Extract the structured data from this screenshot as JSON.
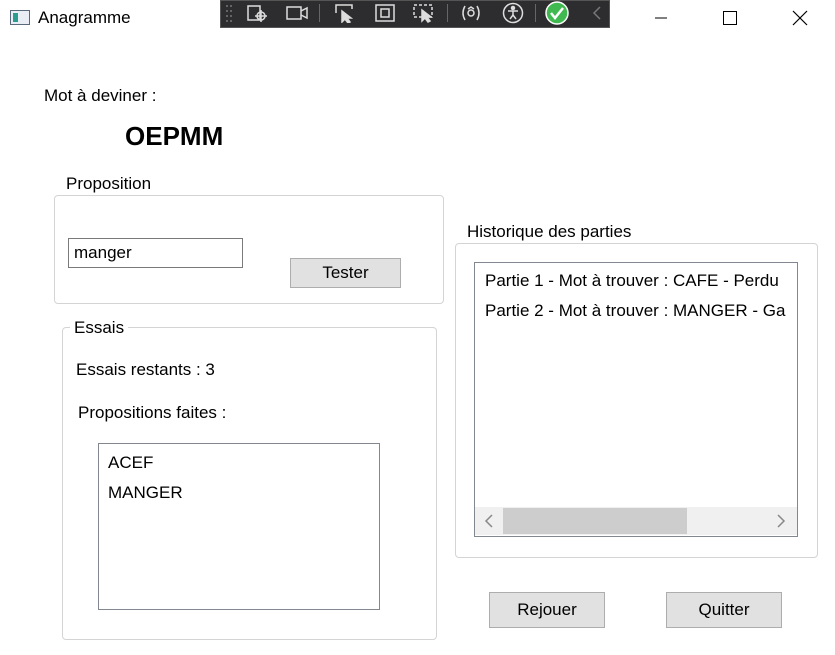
{
  "window": {
    "title": "Anagramme",
    "icon": "app-window-icon",
    "controls": [
      "minimize-icon",
      "maximize-icon",
      "close-icon"
    ]
  },
  "debug_toolbar": {
    "icons": [
      "grip-icon",
      "select-element-icon",
      "video-camera-icon",
      "pointer-select-icon",
      "display-layout-icon",
      "track-focus-icon",
      "hot-reload-icon",
      "accessibility-icon",
      "check-circle-icon",
      "collapse-chevron-icon"
    ]
  },
  "word": {
    "caption": "Mot à deviner :",
    "value": "OEPMM"
  },
  "proposition": {
    "title": "Proposition",
    "input_value": "manger",
    "test_label": "Tester"
  },
  "essais": {
    "title": "Essais",
    "remaining": "Essais restants : 3",
    "proposals_caption": "Propositions faites :",
    "proposals": [
      "ACEF",
      "MANGER"
    ]
  },
  "history": {
    "title": "Historique des parties",
    "items": [
      "Partie 1 - Mot à trouver : CAFE - Perdu",
      "Partie 2 - Mot à trouver : MANGER - Ga"
    ]
  },
  "buttons": {
    "replay": "Rejouer",
    "quit": "Quitter"
  },
  "colors": {
    "button_bg": "#e1e1e1",
    "button_border": "#adadad",
    "groupbox_border": "#d4d4d4",
    "toolbar_bg": "#2d2d30",
    "check_green": "#3fb950"
  }
}
